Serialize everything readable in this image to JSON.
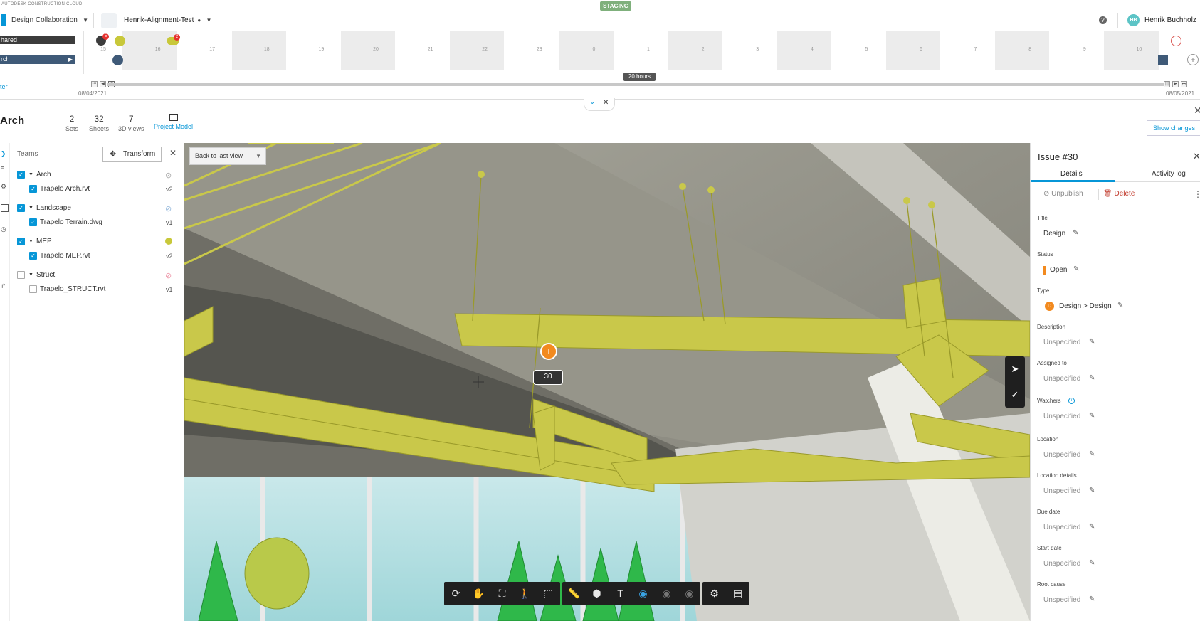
{
  "topbar": {
    "brand": "AUTODESK CONSTRUCTION CLOUD",
    "environment": "STAGING",
    "product": "Design Collaboration",
    "project": "Henrik-Alignment-Test",
    "user_initials": "HB",
    "user_name": "Henrik Buchholz"
  },
  "timeline": {
    "side_label_top": "hared",
    "side_label_bottom": "rch",
    "filter_link": "ter",
    "hours": [
      "15",
      "16",
      "17",
      "18",
      "19",
      "20",
      "21",
      "22",
      "23",
      "0",
      "1",
      "2",
      "3",
      "4",
      "5",
      "6",
      "7",
      "8",
      "9",
      "10"
    ],
    "badge_a": "5",
    "badge_b": "2",
    "duration": "20 hours",
    "start_date": "08/04/2021",
    "end_date": "08/05/2021"
  },
  "header": {
    "title": "Arch",
    "sets_count": "2",
    "sets_label": "Sets",
    "sheets_count": "32",
    "sheets_label": "Sheets",
    "views_count": "7",
    "views_label": "3D views",
    "project_model": "Project Model",
    "show_changes": "Show changes"
  },
  "left_panel": {
    "title": "Teams",
    "transform_label": "Transform",
    "teams": [
      {
        "name": "Arch",
        "checked": true,
        "file": "Trapelo Arch.rvt",
        "file_checked": true,
        "version": "v2"
      },
      {
        "name": "Landscape",
        "checked": true,
        "file": "Trapelo Terrain.dwg",
        "file_checked": true,
        "version": "v1"
      },
      {
        "name": "MEP",
        "checked": true,
        "file": "Trapelo MEP.rvt",
        "file_checked": true,
        "version": "v2"
      },
      {
        "name": "Struct",
        "checked": false,
        "file": "Trapelo_STRUCT.rvt",
        "file_checked": false,
        "version": "v1"
      }
    ]
  },
  "viewer": {
    "back_label": "Back to last view",
    "issue_number": "30"
  },
  "issue": {
    "title": "Issue #30",
    "tab_details": "Details",
    "tab_activity": "Activity log",
    "unpublish": "Unpublish",
    "delete": "Delete",
    "fields": {
      "title_label": "Title",
      "title_value": "Design",
      "status_label": "Status",
      "status_value": "Open",
      "type_label": "Type",
      "type_badge": "D",
      "type_value": "Design > Design",
      "description_label": "Description",
      "description_value": "Unspecified",
      "assigned_label": "Assigned to",
      "assigned_value": "Unspecified",
      "watchers_label": "Watchers",
      "watchers_value": "Unspecified",
      "location_label": "Location",
      "location_value": "Unspecified",
      "location_details_label": "Location details",
      "location_details_value": "Unspecified",
      "due_label": "Due date",
      "due_value": "Unspecified",
      "start_label": "Start date",
      "start_value": "Unspecified",
      "root_cause_label": "Root cause",
      "root_cause_value": "Unspecified"
    }
  },
  "colors": {
    "accent": "#0696d7",
    "issue_orange": "#f28a1f",
    "mep_yellow": "#c8c83a",
    "delete_red": "#c1392b"
  }
}
